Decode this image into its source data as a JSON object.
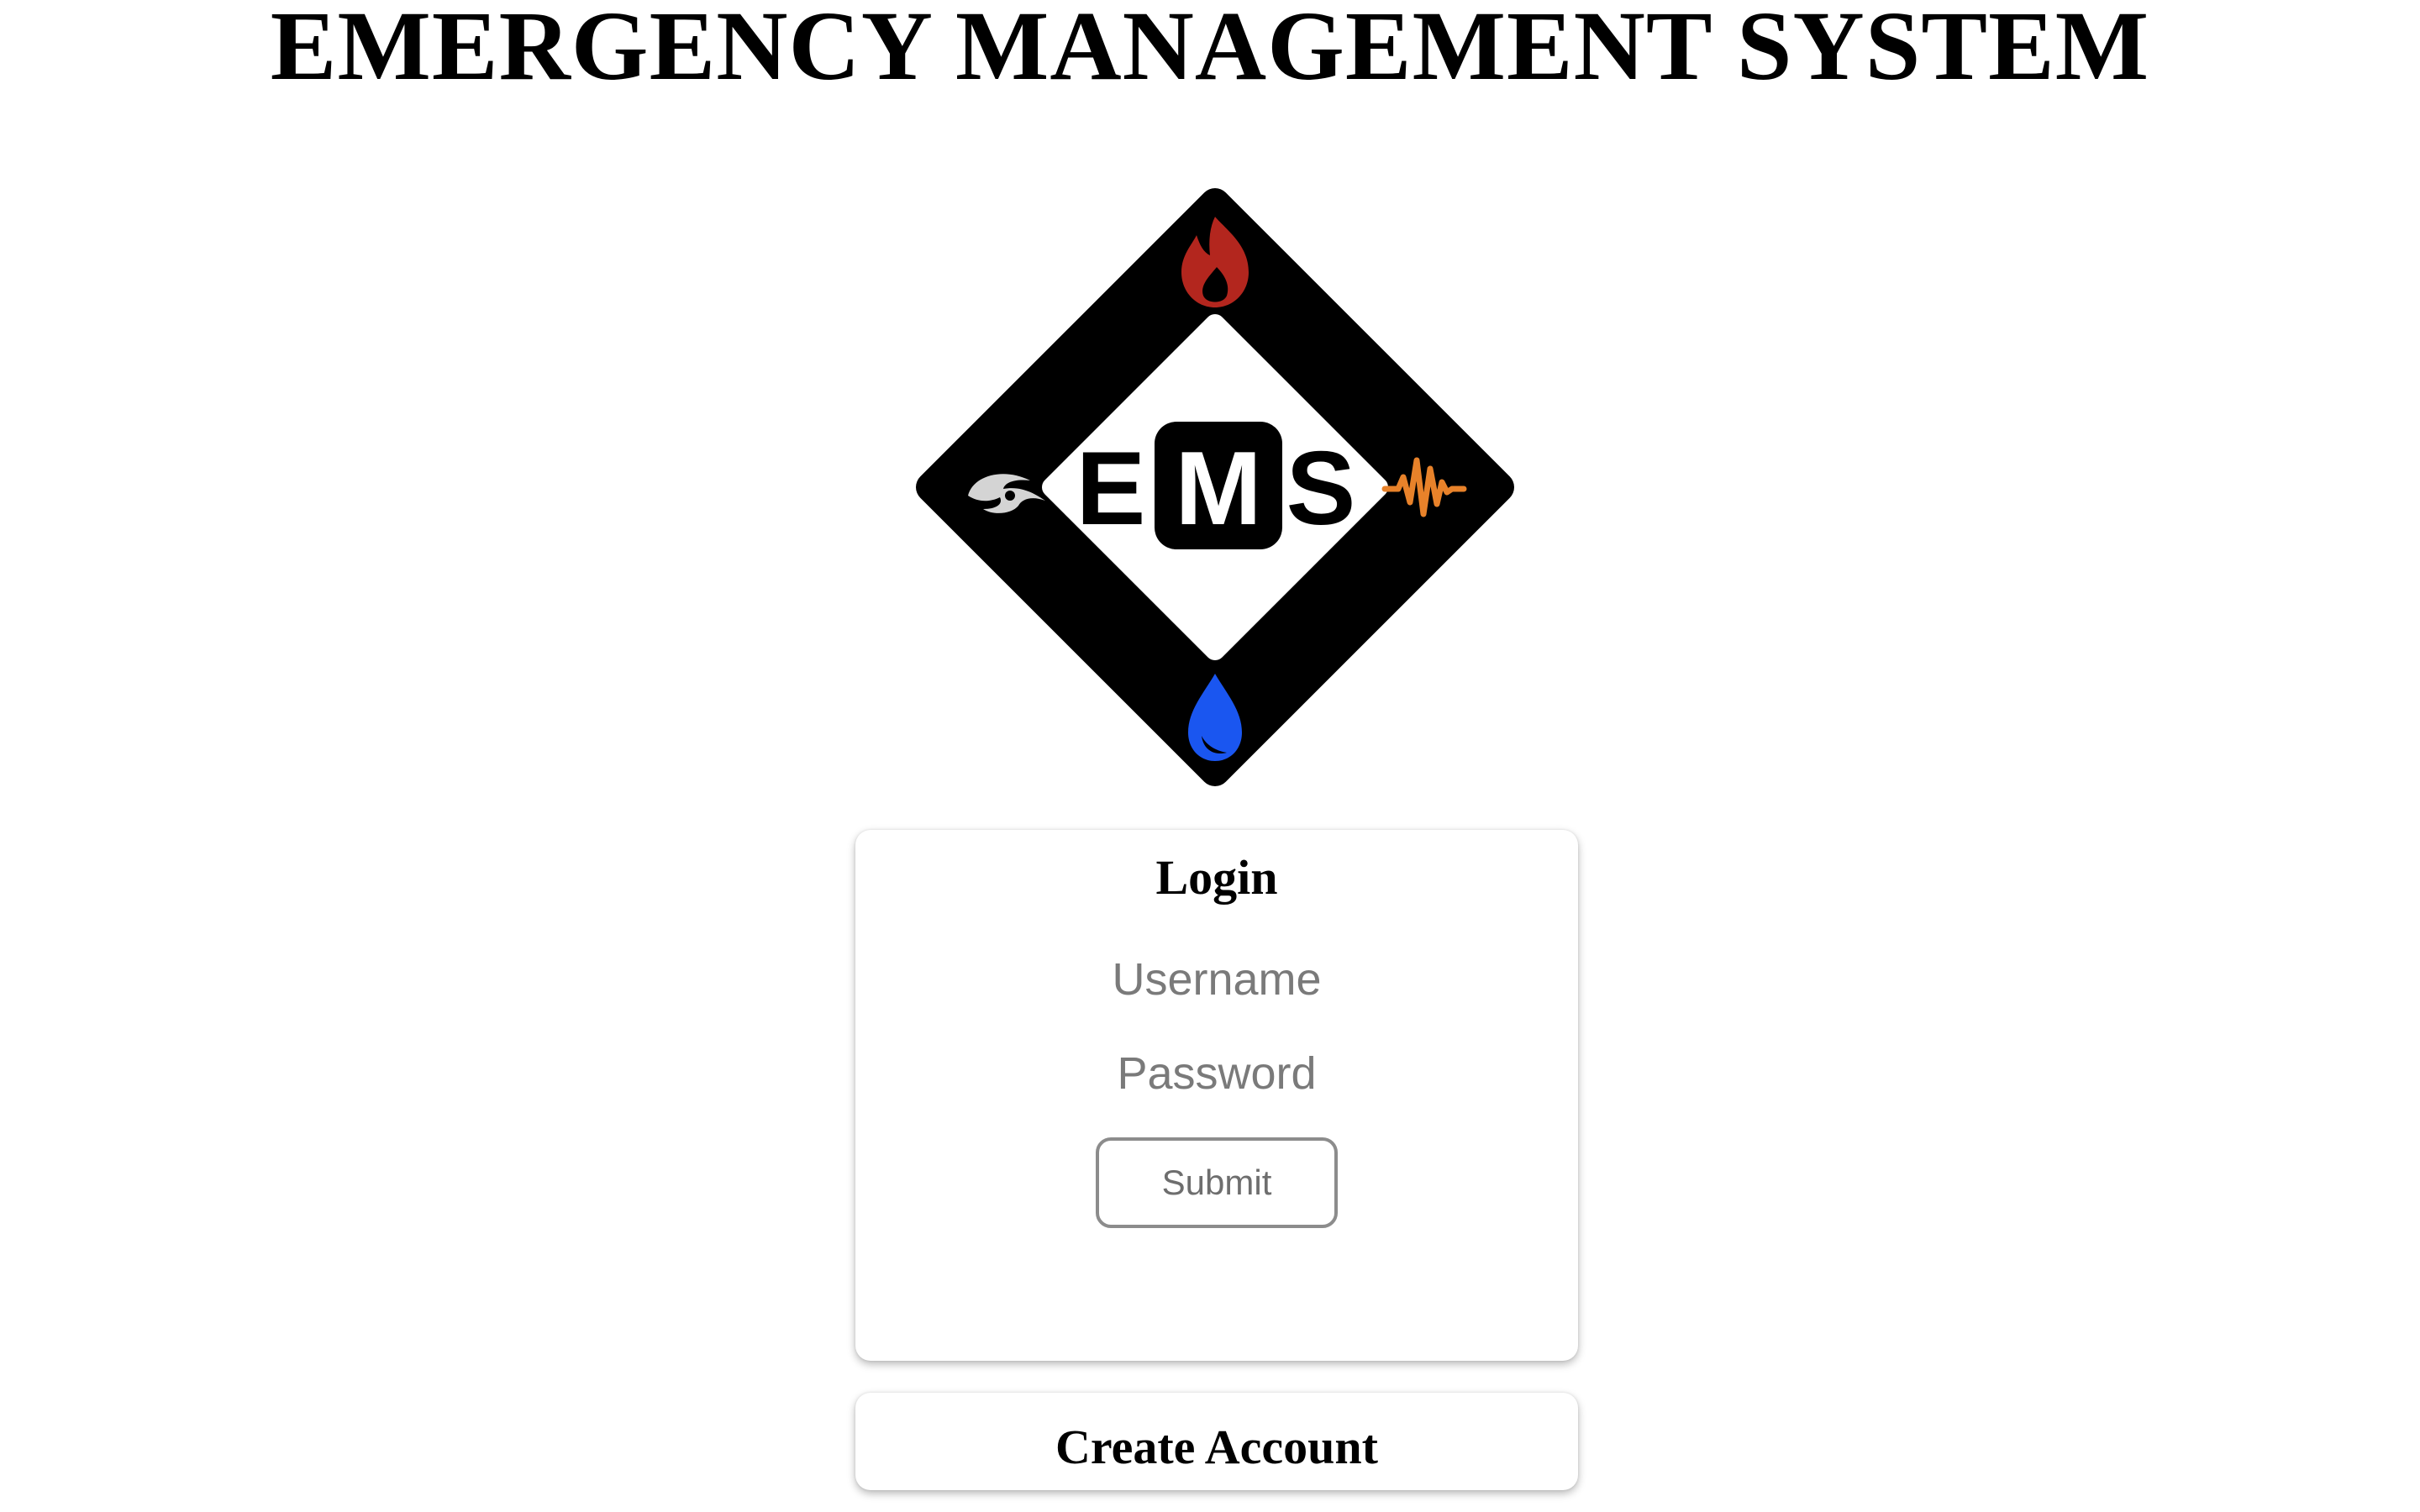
{
  "page": {
    "title": "EMERGENCY MANAGEMENT SYSTEM"
  },
  "logo": {
    "letters": [
      "E",
      "M",
      "S"
    ],
    "icons": {
      "top": "fire-icon",
      "right": "earthquake-icon",
      "bottom": "water-drop-icon",
      "left": "hurricane-icon"
    },
    "colors": {
      "frame": "#000000",
      "fire": "#b3261e",
      "earthquake": "#e8822a",
      "water": "#1a56f0",
      "hurricane": "#d4d4d4"
    }
  },
  "login": {
    "title": "Login",
    "username_placeholder": "Username",
    "username_value": "",
    "password_placeholder": "Password",
    "password_value": "",
    "submit_label": "Submit"
  },
  "create_account": {
    "label": "Create Account"
  }
}
